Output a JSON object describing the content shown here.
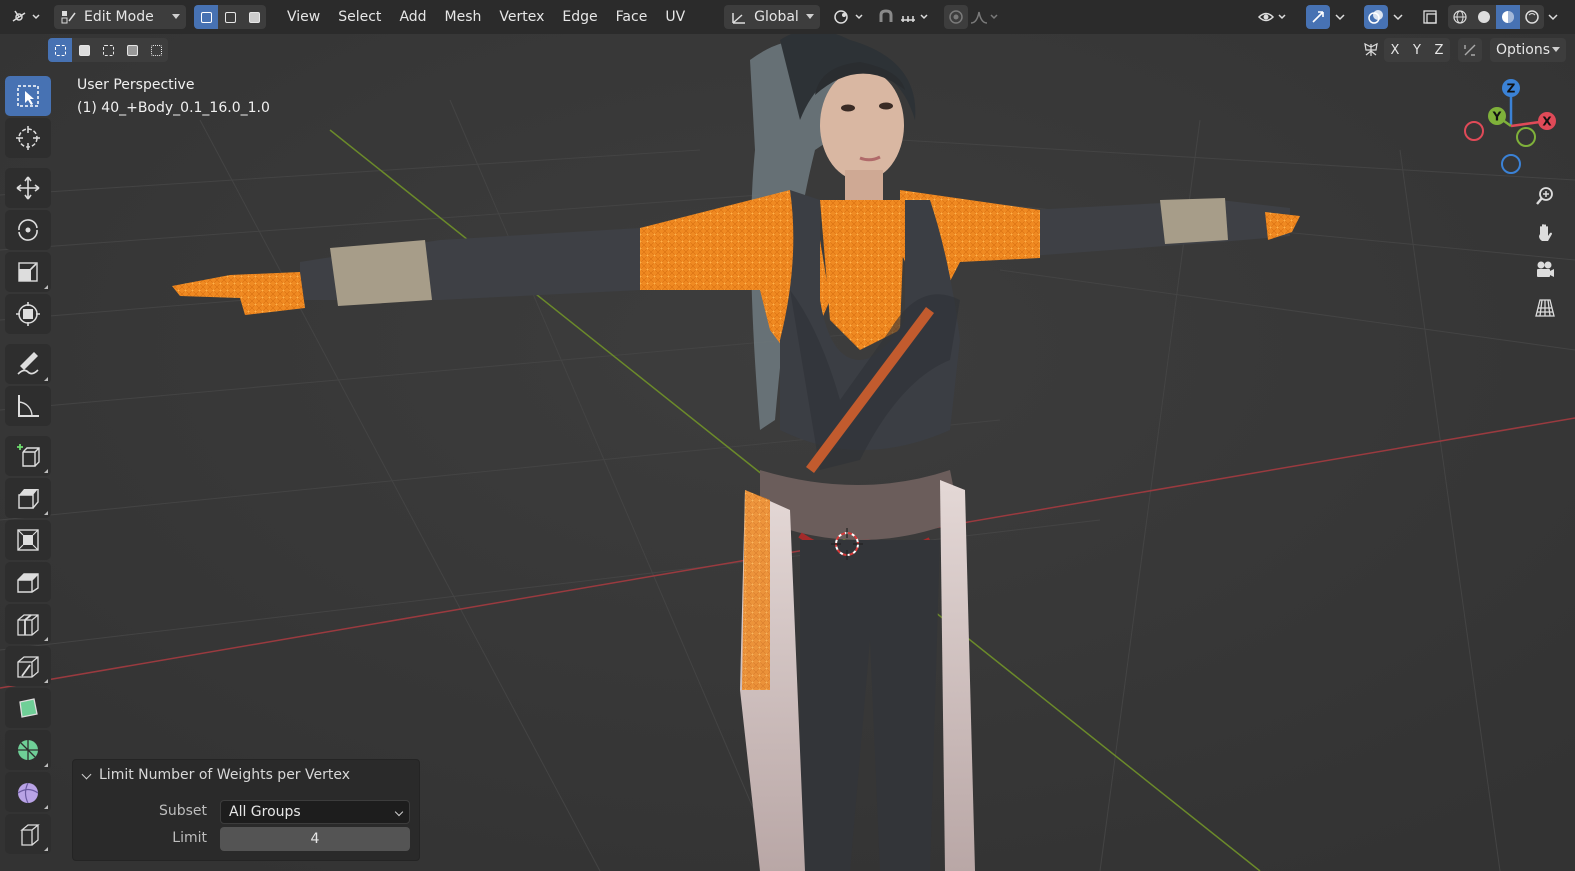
{
  "header": {
    "mode_label": "Edit Mode",
    "menus": [
      "View",
      "Select",
      "Add",
      "Mesh",
      "Vertex",
      "Edge",
      "Face",
      "UV"
    ],
    "transform_orientation": "Global"
  },
  "options_label": "Options",
  "axes": {
    "x": "X",
    "y": "Y",
    "z": "Z"
  },
  "viewport": {
    "title": "User Perspective",
    "object": "(1) 40_+Body_0.1_16.0_1.0"
  },
  "gizmo": {
    "z": "Z",
    "y": "Y",
    "x": "X"
  },
  "operator_panel": {
    "title": "Limit Number of Weights per Vertex",
    "subset_label": "Subset",
    "subset_value": "All Groups",
    "limit_label": "Limit",
    "limit_value": "4"
  },
  "colors": {
    "accent": "#4772b3",
    "selection": "#ff8c1a",
    "header_bg": "#2b2b2b",
    "viewport_bg": "#3a3a3a"
  },
  "icons": {
    "editor_type": "editor-type-icon",
    "tools": [
      "select-box-icon",
      "cursor-icon",
      "move-icon",
      "rotate-icon",
      "scale-icon",
      "transform-icon",
      "annotate-icon",
      "measure-icon",
      "add-cube-icon",
      "extrude-icon",
      "inset-icon",
      "bevel-icon",
      "loop-cut-icon",
      "knife-icon",
      "poly-build-icon",
      "spin-icon",
      "smooth-icon",
      "shear-icon"
    ]
  }
}
